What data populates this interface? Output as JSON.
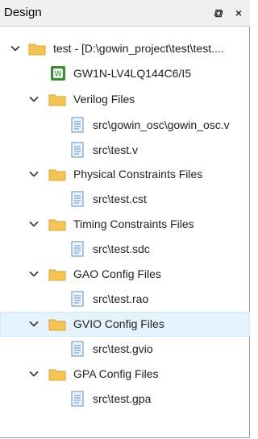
{
  "panel": {
    "title": "Design",
    "float_glyph": "⧉",
    "close_glyph": "×"
  },
  "tree": {
    "project": "test - [D:\\gowin_project\\test\\test....",
    "device": "GW1N-LV4LQ144C6/I5",
    "groups": [
      {
        "label": "Verilog Files",
        "files": [
          "src\\gowin_osc\\gowin_osc.v",
          "src\\test.v"
        ]
      },
      {
        "label": "Physical Constraints Files",
        "files": [
          "src\\test.cst"
        ]
      },
      {
        "label": "Timing Constraints Files",
        "files": [
          "src\\test.sdc"
        ]
      },
      {
        "label": "GAO Config Files",
        "files": [
          "src\\test.rao"
        ]
      },
      {
        "label": "GVIO Config Files",
        "files": [
          "src\\test.gvio"
        ]
      },
      {
        "label": "GPA Config Files",
        "files": [
          "src\\test.gpa"
        ]
      }
    ]
  },
  "colors": {
    "selection": "#e5f3ff",
    "folder": "#f6c453",
    "file": "#5b8fd6",
    "chip": "#3a8a3a"
  }
}
